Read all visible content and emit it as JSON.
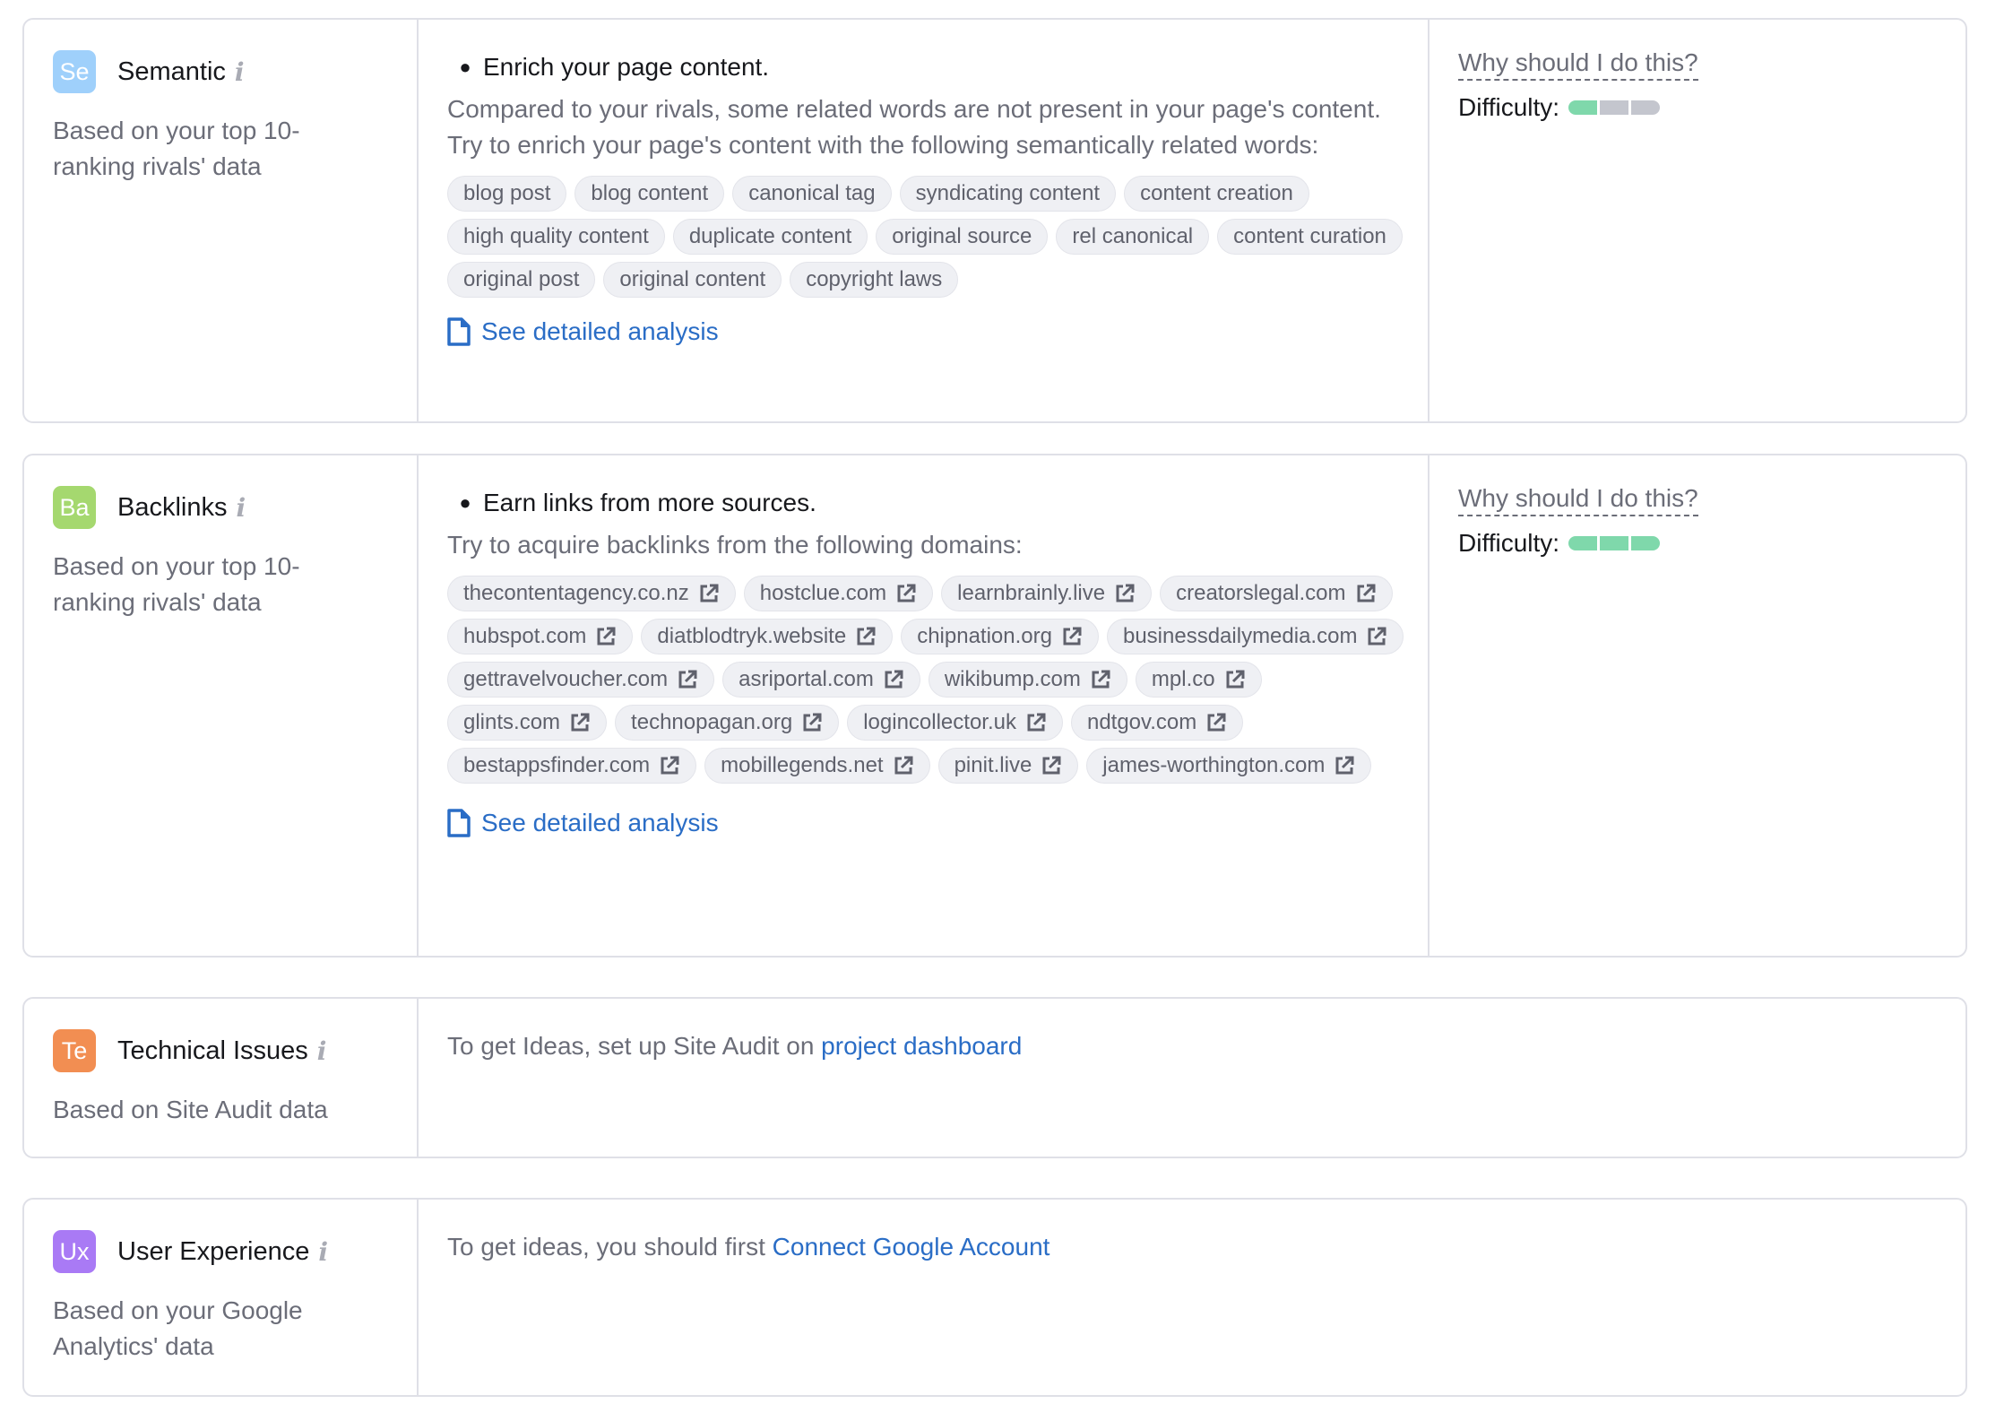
{
  "colors": {
    "semantic_badge": "#9fd0fb",
    "backlinks_badge": "#a5d86f",
    "technical_badge": "#f28e52",
    "ux_badge": "#a97af5",
    "link": "#2a6dc6",
    "difficulty_filled": "#7fd8ab",
    "difficulty_empty": "#c4c6ce"
  },
  "semantic": {
    "badge": "Se",
    "title": "Semantic",
    "info_icon": "info-icon",
    "subtitle": "Based on your top 10-ranking rivals' data",
    "bullet": "Enrich your page content.",
    "paragraph1": "Compared to your rivals, some related words are not present in your page's content.",
    "paragraph2": "Try to enrich your page's content with the following semantically related words:",
    "words": [
      "blog post",
      "blog content",
      "canonical tag",
      "syndicating content",
      "content creation",
      "high quality content",
      "duplicate content",
      "original source",
      "rel canonical",
      "content curation",
      "original post",
      "original content",
      "copyright laws"
    ],
    "detail_link": "See detailed analysis",
    "why_link": "Why should I do this?",
    "difficulty_label": "Difficulty:",
    "difficulty_level": 1,
    "difficulty_max": 3
  },
  "backlinks": {
    "badge": "Ba",
    "title": "Backlinks",
    "info_icon": "info-icon",
    "subtitle": "Based on your top 10-ranking rivals' data",
    "bullet": "Earn links from more sources.",
    "paragraph1": "Try to acquire backlinks from the following domains:",
    "domains": [
      "thecontentagency.co.nz",
      "hostclue.com",
      "learnbrainly.live",
      "creatorslegal.com",
      "hubspot.com",
      "diatblodtryk.website",
      "chipnation.org",
      "businessdailymedia.com",
      "gettravelvoucher.com",
      "asriportal.com",
      "wikibump.com",
      "mpl.co",
      "glints.com",
      "technopagan.org",
      "logincollector.uk",
      "ndtgov.com",
      "bestappsfinder.com",
      "mobillegends.net",
      "pinit.live",
      "james-worthington.com"
    ],
    "detail_link": "See detailed analysis",
    "why_link": "Why should I do this?",
    "difficulty_label": "Difficulty:",
    "difficulty_level": 3,
    "difficulty_max": 3
  },
  "technical": {
    "badge": "Te",
    "title": "Technical Issues",
    "info_icon": "info-icon",
    "subtitle": "Based on Site Audit data",
    "message": "To get Ideas, set up Site Audit on ",
    "link": "project dashboard"
  },
  "ux": {
    "badge": "Ux",
    "title": "User Experience",
    "info_icon": "info-icon",
    "subtitle": "Based on your Google Analytics' data",
    "message": "To get ideas, you should first ",
    "link": "Connect Google Account"
  }
}
